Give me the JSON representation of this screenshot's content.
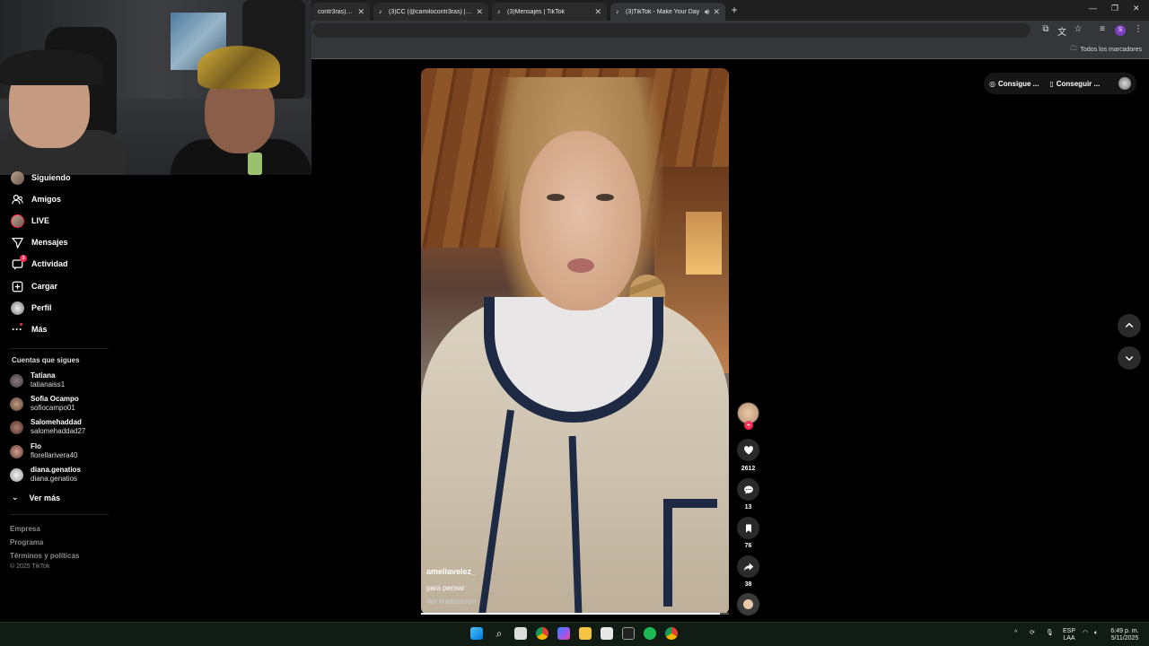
{
  "browser": {
    "tabs": [
      {
        "title": "contr3ras) | TikT",
        "active": false
      },
      {
        "title": "(3)CC (@camilocontr3ras) | TikT",
        "active": false
      },
      {
        "title": "(3)Mensajes | TikTok",
        "active": false
      },
      {
        "title": "(3)TikTok - Make Your Day",
        "active": true
      }
    ],
    "bookmarks_label": "Todos los marcadores",
    "profile_initial": "S"
  },
  "sidebar": {
    "nav": [
      {
        "label": "Siguiendo",
        "icon": "avatar-icon"
      },
      {
        "label": "Amigos",
        "icon": "friends-icon"
      },
      {
        "label": "LIVE",
        "icon": "live-icon"
      },
      {
        "label": "Mensajes",
        "icon": "messages-icon"
      },
      {
        "label": "Actividad",
        "icon": "activity-icon",
        "badge": "3"
      },
      {
        "label": "Cargar",
        "icon": "upload-icon"
      },
      {
        "label": "Perfil",
        "icon": "profile-icon"
      },
      {
        "label": "Más",
        "icon": "more-icon"
      }
    ],
    "following_title": "Cuentas que sigues",
    "following": [
      {
        "name": "Tatiana",
        "handle": "tatianaiss1"
      },
      {
        "name": "Sofia Ocampo",
        "handle": "sofiocampo01"
      },
      {
        "name": "Salomehaddad",
        "handle": "salomehaddad27"
      },
      {
        "name": "Flo",
        "handle": "florellarivera40"
      },
      {
        "name": "diana.genatios",
        "handle": "diana.genatios"
      }
    ],
    "see_more": "Ver más",
    "footer": [
      "Empresa",
      "Programa",
      "Términos y políticas"
    ],
    "copyright": "© 2025 TikTok"
  },
  "video": {
    "username": "ameliavelez_",
    "description": "para pensar",
    "translate": "Ver traducción",
    "progress": 0.97
  },
  "actions": {
    "likes": "2612",
    "comments": "13",
    "saves": "76",
    "shares": "38",
    "follow_plus": "+"
  },
  "topbar": {
    "get_coins": "Consigue ...",
    "get_app": "Conseguir ..."
  },
  "taskbar": {
    "lang_top": "ESP",
    "lang_bottom": "LAA",
    "time": "6:49 p. m.",
    "date": "5/11/2025"
  },
  "colors": {
    "accent": "#fe2c55",
    "background": "#000000",
    "taskbar": "#111c14"
  }
}
